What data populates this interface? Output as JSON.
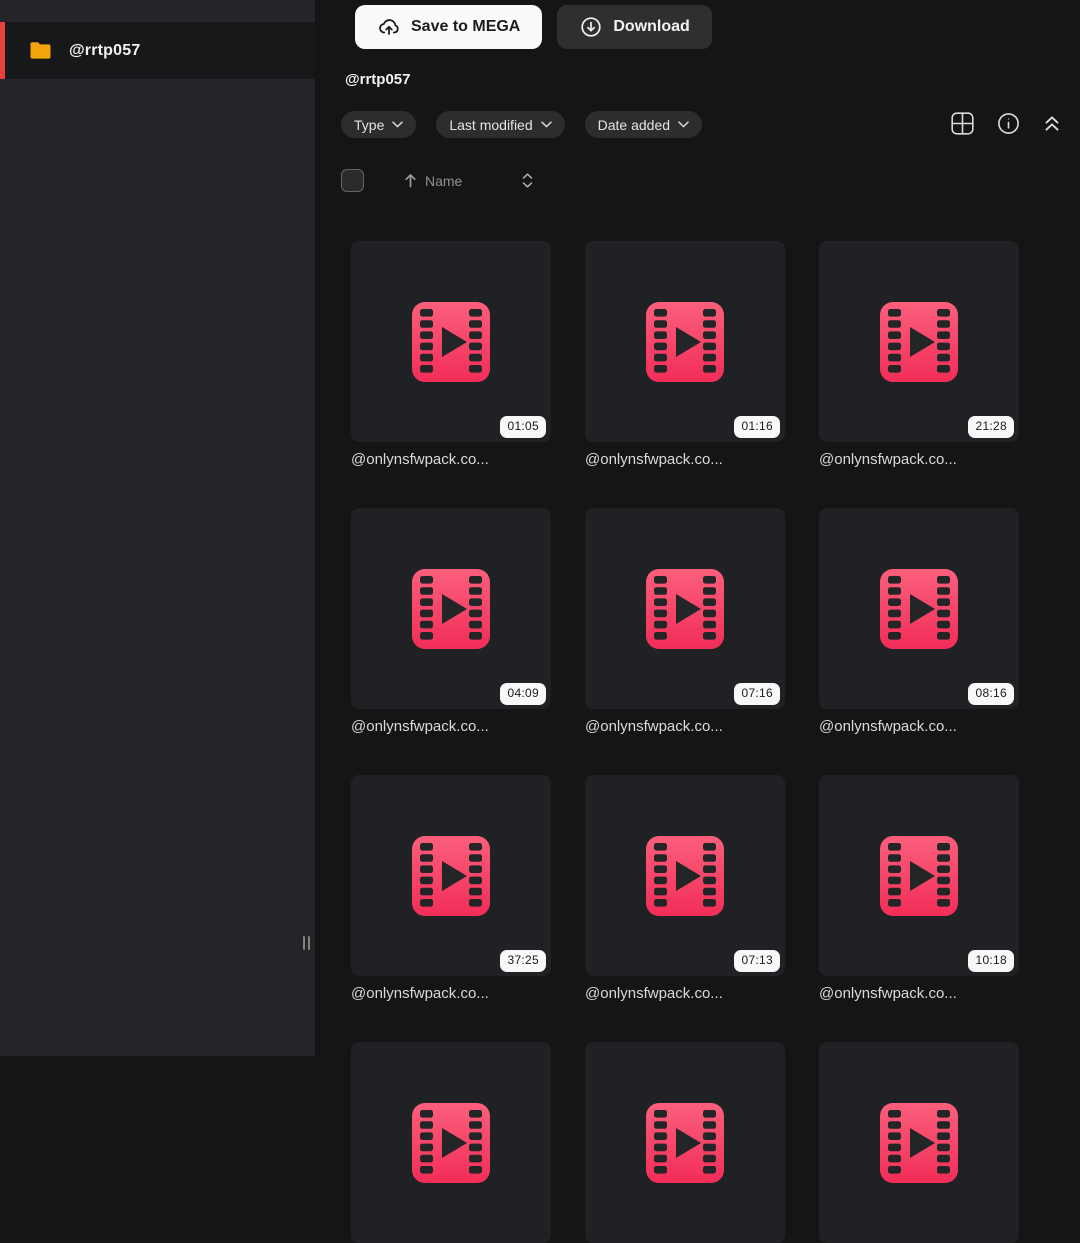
{
  "sidebar": {
    "folder_label": "@rrtp057"
  },
  "toolbar": {
    "save_label": "Save to MEGA",
    "download_label": "Download"
  },
  "breadcrumb": {
    "label": "@rrtp057"
  },
  "filters": {
    "type_label": "Type",
    "modified_label": "Last modified",
    "added_label": "Date added"
  },
  "list_header": {
    "sort_label": "Name"
  },
  "files": [
    {
      "name": "@onlynsfwpack.co...",
      "duration": "01:05"
    },
    {
      "name": "@onlynsfwpack.co...",
      "duration": "01:16"
    },
    {
      "name": "@onlynsfwpack.co...",
      "duration": "21:28"
    },
    {
      "name": "@onlynsfwpack.co...",
      "duration": "04:09"
    },
    {
      "name": "@onlynsfwpack.co...",
      "duration": "07:16"
    },
    {
      "name": "@onlynsfwpack.co...",
      "duration": "08:16"
    },
    {
      "name": "@onlynsfwpack.co...",
      "duration": "37:25"
    },
    {
      "name": "@onlynsfwpack.co...",
      "duration": "07:13"
    },
    {
      "name": "@onlynsfwpack.co...",
      "duration": "10:18"
    }
  ],
  "partial_row": {
    "count": 3
  },
  "colors": {
    "accent_red": "#e8403c",
    "folder_orange": "#f2a50c",
    "file_icon_pink_top": "#fb5f7c",
    "file_icon_pink_bottom": "#f22d58",
    "badge_bg": "#f8f8f8"
  }
}
